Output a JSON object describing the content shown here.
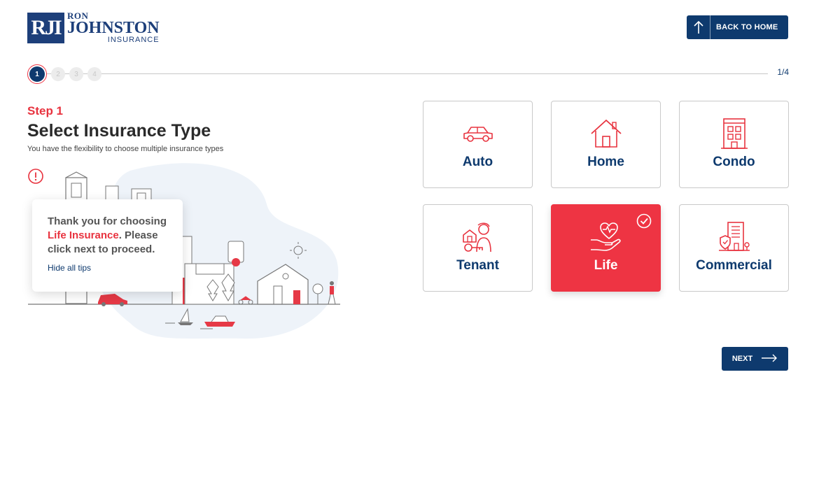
{
  "brand": {
    "logo_mark": "RJI",
    "logo_ron": "RON",
    "logo_johnston": "JOHNSTON",
    "logo_insurance": "INSURANCE",
    "primary_color": "#0e3a6e",
    "accent_color": "#ee3443"
  },
  "header": {
    "back_label": "BACK TO HOME",
    "back_icon": "arrow-up-icon"
  },
  "progress": {
    "steps": [
      "1",
      "2",
      "3",
      "4"
    ],
    "current": 1,
    "count_label": "1/4"
  },
  "step": {
    "label": "Step 1",
    "title": "Select Insurance Type",
    "subtitle": "You have the flexibility to choose multiple insurance types"
  },
  "tip": {
    "text_before": "Thank you for choosing ",
    "text_highlight": "Life Insurance",
    "text_after": ". Please click next to proceed.",
    "hide_link": "Hide all tips",
    "icon": "alert-circle-icon"
  },
  "insurance_types": [
    {
      "label": "Auto",
      "icon": "car-icon",
      "selected": false
    },
    {
      "label": "Home",
      "icon": "house-icon",
      "selected": false
    },
    {
      "label": "Condo",
      "icon": "building-icon",
      "selected": false
    },
    {
      "label": "Tenant",
      "icon": "tenant-icon",
      "selected": false
    },
    {
      "label": "Life",
      "icon": "heart-hand-icon",
      "selected": true
    },
    {
      "label": "Commercial",
      "icon": "commercial-icon",
      "selected": false
    }
  ],
  "footer": {
    "next_label": "NEXT",
    "next_icon": "arrow-right-icon"
  }
}
